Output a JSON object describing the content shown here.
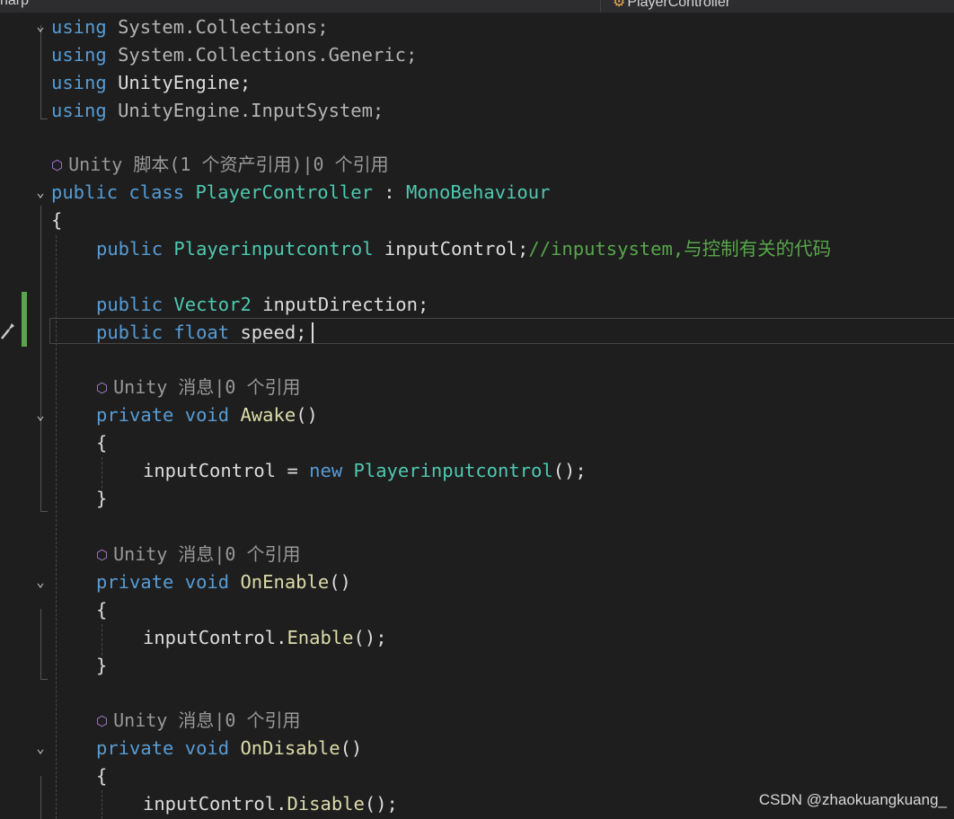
{
  "tab_bar": {
    "left_fragment": "harp",
    "nav_dropdown": {
      "icon": "class-icon",
      "label": "PlayerController"
    }
  },
  "code": {
    "usings": [
      {
        "keyword": "using",
        "ns": "System",
        "rest": ".Collections;"
      },
      {
        "keyword": "using",
        "ns": "System",
        "rest": ".Collections.Generic;"
      },
      {
        "keyword": "using",
        "ns": "UnityEngine",
        "rest": ";"
      },
      {
        "keyword": "using",
        "ns": "UnityEngine",
        "rest": ".InputSystem;"
      }
    ],
    "class_lens": "Unity 脚本(1 个资产引用)|0 个引用",
    "class_decl": {
      "kw1": "public",
      "kw2": "class",
      "name": "PlayerController",
      "colon": " : ",
      "base": "MonoBehaviour"
    },
    "open_brace": "{",
    "close_brace": "}",
    "field_input": {
      "kw": "public",
      "type": "Playerinputcontrol",
      "name": "inputControl;",
      "comment": "//inputsystem,与控制有关的代码"
    },
    "field_dir": {
      "kw": "public",
      "type": "Vector2",
      "name": "inputDirection;"
    },
    "field_speed": {
      "kw": "public",
      "type": "float",
      "name": "speed;"
    },
    "method_lens": "Unity 消息|0 个引用",
    "awake": {
      "kw1": "private",
      "kw2": "void",
      "name": "Awake",
      "parens": "()",
      "body_var": "inputControl",
      "body_op": " = ",
      "body_new": "new",
      "body_type": "Playerinputcontrol",
      "body_end": "();"
    },
    "onenable": {
      "kw1": "private",
      "kw2": "void",
      "name": "OnEnable",
      "parens": "()",
      "body_var": "inputControl.",
      "body_call": "Enable",
      "body_end": "();"
    },
    "ondisable": {
      "kw1": "private",
      "kw2": "void",
      "name": "OnDisable",
      "parens": "()",
      "body_var": "inputControl.",
      "body_call": "Disable",
      "body_end": "();"
    }
  },
  "watermark": "CSDN @zhaokuangkuang_"
}
